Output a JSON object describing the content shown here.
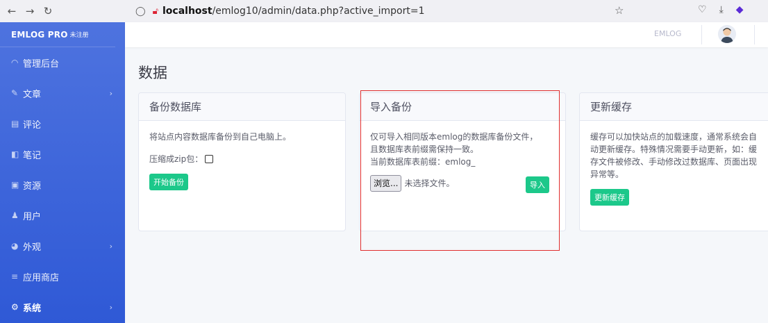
{
  "browser": {
    "url_host": "localhost",
    "url_path": "/emlog10/admin/data.php?active_import=1"
  },
  "sidebar": {
    "brand": "EMLOG PRO",
    "brand_tag": "未注册",
    "items": [
      {
        "label": "管理后台",
        "icon": "dashboard-icon"
      },
      {
        "label": "文章",
        "icon": "pencil-icon",
        "has_children": true
      },
      {
        "label": "评论",
        "icon": "comment-icon"
      },
      {
        "label": "笔记",
        "icon": "note-icon"
      },
      {
        "label": "资源",
        "icon": "image-icon"
      },
      {
        "label": "用户",
        "icon": "user-icon"
      },
      {
        "label": "外观",
        "icon": "palette-icon",
        "has_children": true
      },
      {
        "label": "应用商店",
        "icon": "store-icon"
      },
      {
        "label": "系统",
        "icon": "gear-icon",
        "has_children": true,
        "active": true
      }
    ]
  },
  "topbar": {
    "site_link": "EMLOG"
  },
  "page": {
    "title": "数据"
  },
  "backup": {
    "title": "备份数据库",
    "desc": "将站点内容数据库备份到自己电脑上。",
    "zip_label": "压缩成zip包：",
    "button": "开始备份"
  },
  "import": {
    "title": "导入备份",
    "desc_line1": "仅可导入相同版本emlog的数据库备份文件，",
    "desc_line2": "且数据库表前缀需保持一致。",
    "prefix_line": "当前数据库表前缀：emlog_",
    "browse": "浏览...",
    "no_file": "未选择文件。",
    "button": "导入"
  },
  "cache": {
    "title": "更新缓存",
    "desc_line1": "缓存可以加快站点的加载速度，通常系统会自",
    "desc_line2": "动更新缓存。特殊情况需要手动更新，如：缓",
    "desc_line3": "存文件被修改、手动修改过数据库、页面出现",
    "desc_line4": "异常等。",
    "button": "更新缓存"
  },
  "colors": {
    "sidebar": "#4e73df",
    "success": "#1cc88a",
    "highlight": "#e02d2d"
  }
}
